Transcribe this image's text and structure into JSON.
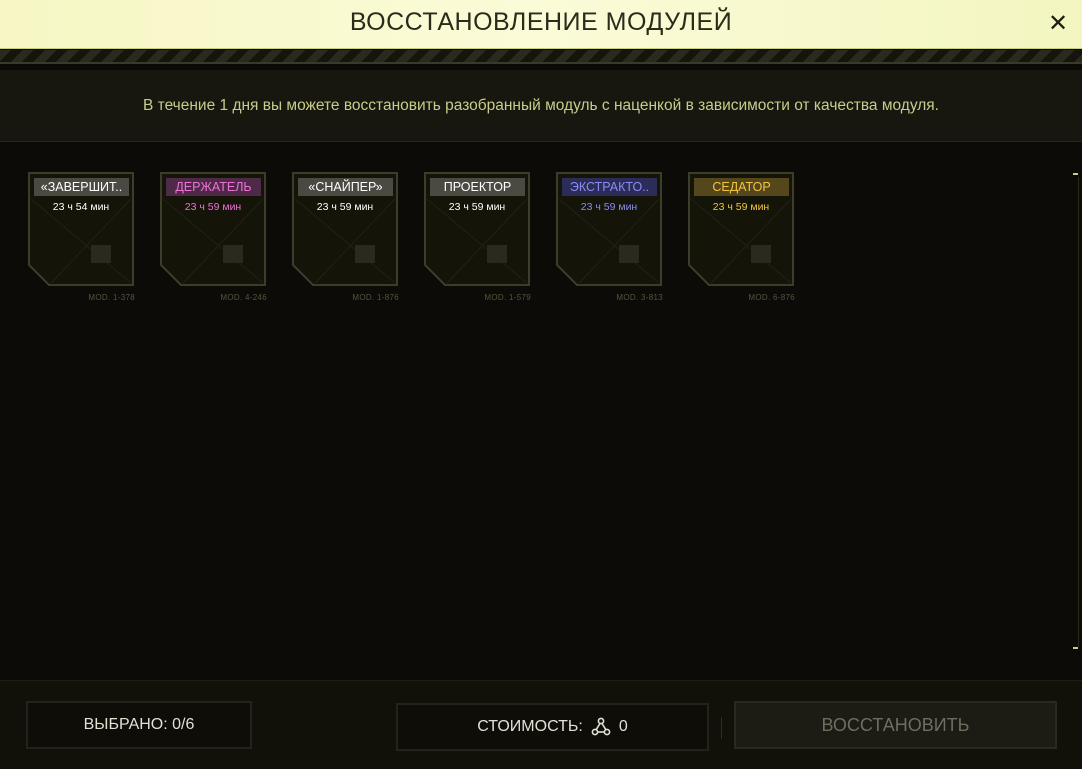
{
  "header": {
    "title": "ВОССТАНОВЛЕНИЕ МОДУЛЕЙ",
    "close_label": "✕"
  },
  "info": {
    "text": "В течение 1 дня вы можете восстановить разобранный модуль с наценкой в зависимости от качества модуля."
  },
  "modules": [
    {
      "name": "«ЗАВЕРШИТ..",
      "timer": "23 ч 54 мин",
      "mod": "MOD. 1-378",
      "name_bg": "#4a4a42",
      "name_color": "#ffffff",
      "timer_color": "#ffffff"
    },
    {
      "name": "ДЕРЖАТЕЛЬ",
      "timer": "23 ч 59 мин",
      "mod": "MOD. 4-246",
      "name_bg": "#4e2a48",
      "name_color": "#ee72d6",
      "timer_color": "#ee72d6"
    },
    {
      "name": "«СНАЙПЕР»",
      "timer": "23 ч 59 мин",
      "mod": "MOD. 1-876",
      "name_bg": "#4a4a42",
      "name_color": "#ffffff",
      "timer_color": "#ffffff"
    },
    {
      "name": "ПРОЕКТОР",
      "timer": "23 ч 59 мин",
      "mod": "MOD. 1-579",
      "name_bg": "#4a4a42",
      "name_color": "#ffffff",
      "timer_color": "#ffffff"
    },
    {
      "name": "ЭКСТРАКТО..",
      "timer": "23 ч 59 мин",
      "mod": "MOD. 3-813",
      "name_bg": "#2b2c58",
      "name_color": "#8a8cf2",
      "timer_color": "#8a8cf2"
    },
    {
      "name": "СЕДАТОР",
      "timer": "23 ч 59 мин",
      "mod": "MOD. 6-876",
      "name_bg": "#55471c",
      "name_color": "#f2c442",
      "timer_color": "#f2c442"
    }
  ],
  "footer": {
    "selected_label": "ВЫБРАНО: 0/6",
    "cost_label": "СТОИМОСТЬ:",
    "cost_value": "0",
    "cost_icon": "molecule-icon",
    "restore_label": "ВОССТАНОВИТЬ"
  },
  "colors": {
    "accent": "#c9cc8a",
    "header_bg": "#f8f9cc",
    "frame": "#3d3d2c"
  }
}
